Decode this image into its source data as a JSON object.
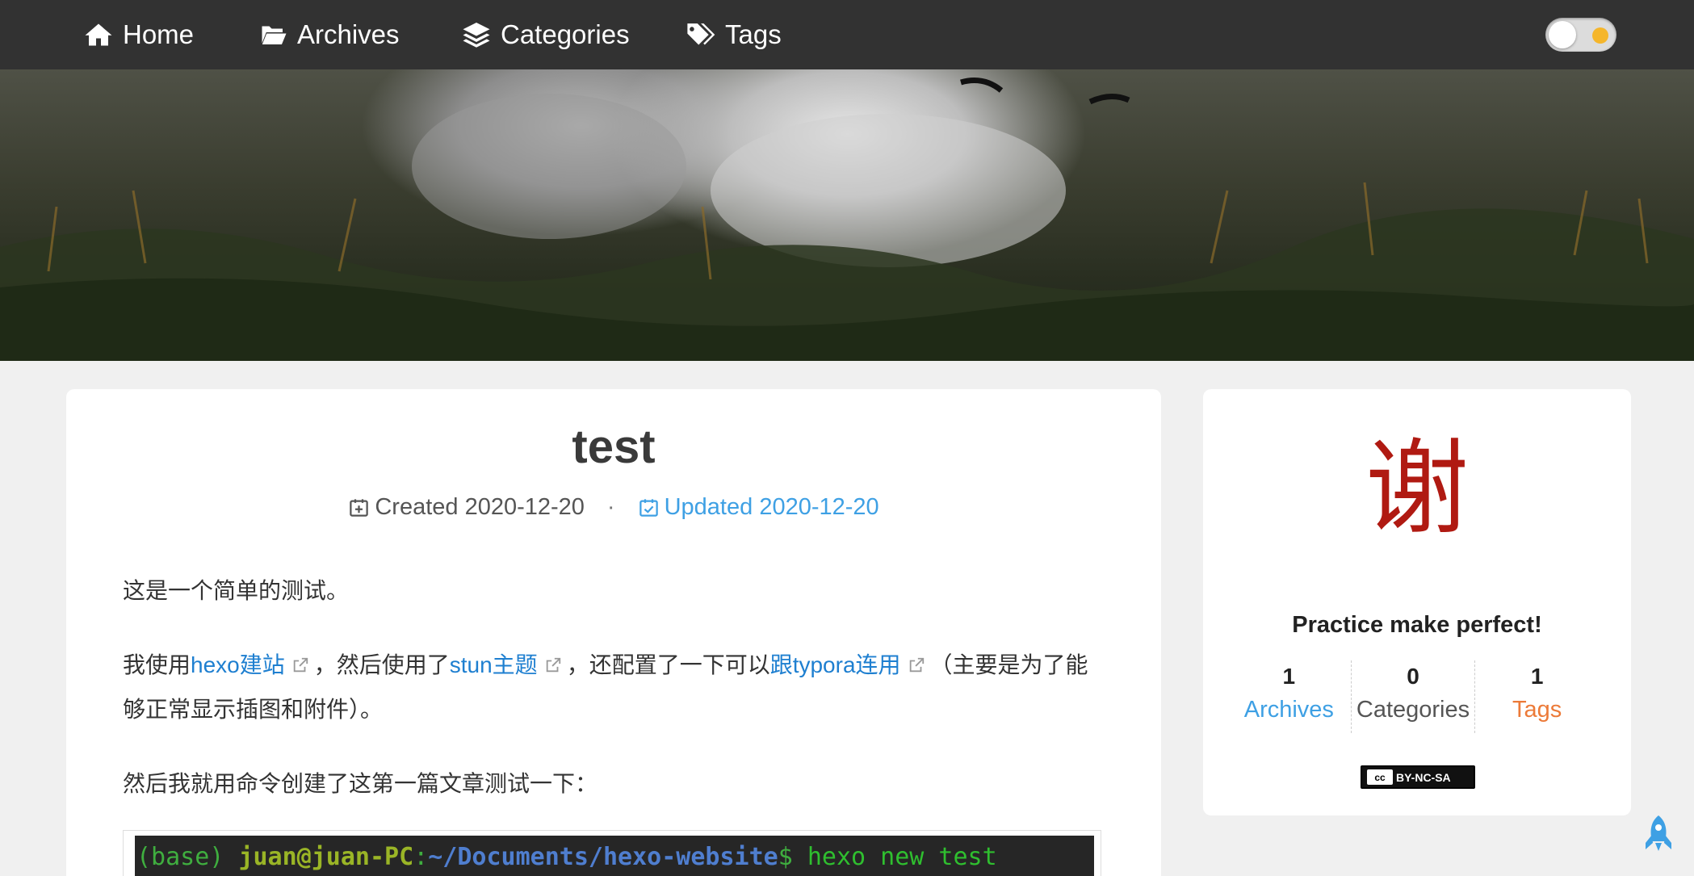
{
  "nav": {
    "home": "Home",
    "archives": "Archives",
    "categories": "Categories",
    "tags": "Tags"
  },
  "post": {
    "title": "test",
    "created_label": "Created",
    "created_date": "2020-12-20",
    "separator": "·",
    "updated_label": "Updated",
    "updated_date": "2020-12-20",
    "p1": "这是一个简单的测试。",
    "p2_a": "我使用",
    "p2_link1": "hexo建站",
    "p2_b": "，然后使用了",
    "p2_link2": "stun主题",
    "p2_c": "，还配置了一下可以",
    "p2_link3": "跟typora连用",
    "p2_d": "（主要是为了能够正常显示插图和附件）。",
    "p3": "然后我就用命令创建了这第一篇文章测试一下：",
    "code": {
      "env": "(base)",
      "user": "juan@juan-PC",
      "colon": ":",
      "path": "~/Documents/hexo-website",
      "prompt": "$",
      "command": " hexo new test"
    }
  },
  "sidebar": {
    "avatar_char": "谢",
    "motto": "Practice make perfect!",
    "stats": [
      {
        "num": "1",
        "label": "Archives"
      },
      {
        "num": "0",
        "label": "Categories"
      },
      {
        "num": "1",
        "label": "Tags"
      }
    ],
    "license": {
      "badge": "cc",
      "text": "BY-NC-SA"
    }
  },
  "colors": {
    "nav_bg": "#323232",
    "link": "#1e7fd0",
    "accent_blue": "#3ea0e4",
    "accent_orange": "#ec7a38",
    "avatar_red": "#b01a12"
  },
  "icons": {
    "home": "home-icon",
    "archives": "folder-open-icon",
    "categories": "layers-icon",
    "tags": "tags-icon",
    "theme": "theme-toggle",
    "back_to_top": "rocket-icon"
  }
}
